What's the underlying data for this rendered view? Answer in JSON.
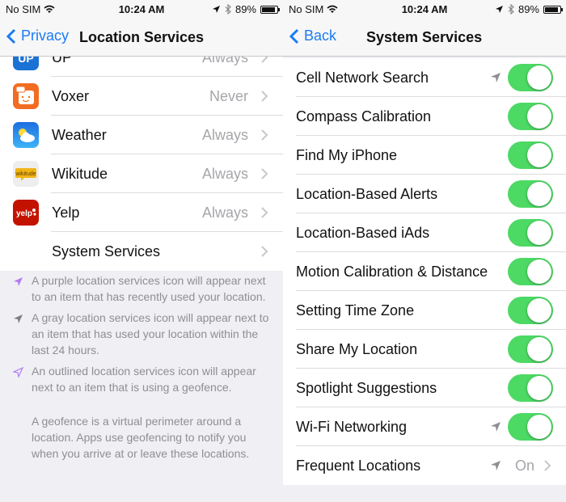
{
  "left": {
    "status": {
      "carrier": "No SIM",
      "time": "10:24 AM",
      "battery": "89%",
      "battery_level": 0.89
    },
    "nav": {
      "back_label": "Privacy",
      "title": "Location Services"
    },
    "apps": [
      {
        "name": "UP",
        "value": "Always",
        "icon": "up-app-icon",
        "color": "#1a72d4"
      },
      {
        "name": "Voxer",
        "value": "Never",
        "icon": "voxer-app-icon",
        "color": "#f26d21"
      },
      {
        "name": "Weather",
        "value": "Always",
        "icon": "weather-app-icon",
        "color": "#2196f3"
      },
      {
        "name": "Wikitude",
        "value": "Always",
        "icon": "wikitude-app-icon",
        "color": "#f2b517"
      },
      {
        "name": "Yelp",
        "value": "Always",
        "icon": "yelp-app-icon",
        "color": "#c41200"
      }
    ],
    "system_services_label": "System Services",
    "footer": {
      "notes": [
        {
          "icon": "purple-location-arrow-icon",
          "color": "#b27cf0",
          "text": "A purple location services icon will appear next to an item that has recently used your location."
        },
        {
          "icon": "gray-location-arrow-icon",
          "color": "#7d7d82",
          "text": "A gray location services icon will appear next to an item that has used your location within the last 24 hours."
        },
        {
          "icon": "outlined-location-arrow-icon",
          "color": "#b27cf0",
          "text": "An outlined location services icon will appear next to an item that is using a geofence."
        }
      ],
      "geofence_text": "A geofence is a virtual perimeter around a location. Apps use geofencing to notify you when you arrive at or leave these locations."
    }
  },
  "right": {
    "status": {
      "carrier": "No SIM",
      "time": "10:24 AM",
      "battery": "89%",
      "battery_level": 0.89
    },
    "nav": {
      "back_label": "Back",
      "title": "System Services"
    },
    "services": [
      {
        "label": "Cell Network Search",
        "on": true,
        "location_icon": "gray"
      },
      {
        "label": "Compass Calibration",
        "on": true,
        "location_icon": ""
      },
      {
        "label": "Find My iPhone",
        "on": true,
        "location_icon": ""
      },
      {
        "label": "Location-Based Alerts",
        "on": true,
        "location_icon": ""
      },
      {
        "label": "Location-Based iAds",
        "on": true,
        "location_icon": ""
      },
      {
        "label": "Motion Calibration & Distance",
        "on": true,
        "location_icon": ""
      },
      {
        "label": "Setting Time Zone",
        "on": true,
        "location_icon": ""
      },
      {
        "label": "Share My Location",
        "on": true,
        "location_icon": ""
      },
      {
        "label": "Spotlight Suggestions",
        "on": true,
        "location_icon": ""
      },
      {
        "label": "Wi-Fi Networking",
        "on": true,
        "location_icon": "gray"
      }
    ],
    "frequent_locations": {
      "label": "Frequent Locations",
      "value": "On",
      "location_icon": "gray"
    }
  },
  "colors": {
    "accent": "#1a7cf3",
    "toggle_on": "#4cd964",
    "secondary_text": "#a6a6ab"
  }
}
